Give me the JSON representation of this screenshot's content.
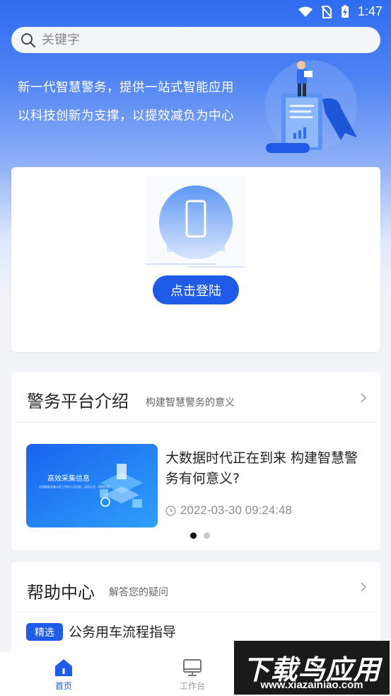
{
  "status_bar": {
    "time": "1:47"
  },
  "search": {
    "placeholder": "关键字",
    "icon": "search-icon"
  },
  "hero": {
    "tagline_1": "新一代智慧警务，提供一站式智能应用",
    "tagline_2": "以科技创新为支撑，以提效减负为中心"
  },
  "login": {
    "button_label": "点击登陆"
  },
  "intro": {
    "title": "警务平台介绍",
    "subtitle": "构建智慧警务的意义",
    "news": {
      "thumb_title": "高效采集信息",
      "thumb_caption": "全面精准采集公民上传的人员信息、流动人员、情报信息",
      "title": "大数据时代正在到来 构建智慧警务有何意义?",
      "time": "2022-03-30 09:24:48"
    },
    "pagination": {
      "count": 2,
      "active": 1
    }
  },
  "help": {
    "title": "帮助中心",
    "subtitle": "解答您的疑问",
    "item_badge": "精选",
    "item_text": "公务用车流程指导"
  },
  "nav": {
    "items": [
      {
        "label": "首页",
        "icon": "home-icon",
        "active": true
      },
      {
        "label": "工作台",
        "icon": "monitor-icon",
        "active": false
      }
    ]
  },
  "watermark": {
    "text_cn": "下载鸟应用",
    "text_url": "www.xiazainiao.com"
  },
  "colors": {
    "primary": "#1f5be6",
    "hero_top": "#2f6cf0",
    "background": "#f2f3f7"
  }
}
